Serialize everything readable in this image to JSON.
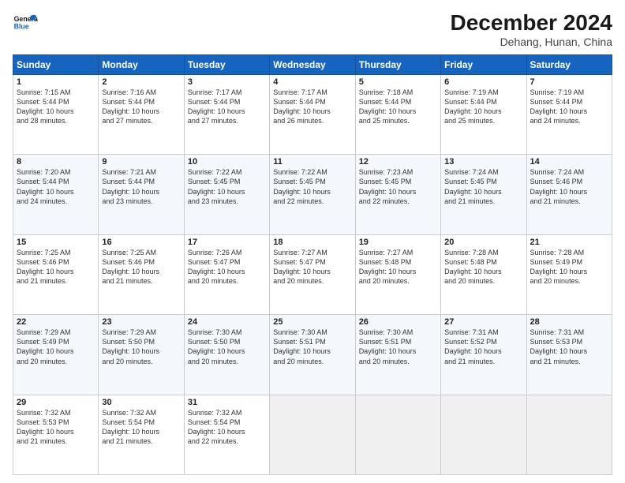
{
  "logo": {
    "line1": "General",
    "line2": "Blue"
  },
  "title": "December 2024",
  "subtitle": "Dehang, Hunan, China",
  "days_of_week": [
    "Sunday",
    "Monday",
    "Tuesday",
    "Wednesday",
    "Thursday",
    "Friday",
    "Saturday"
  ],
  "weeks": [
    [
      {
        "day": 1,
        "info": "Sunrise: 7:15 AM\nSunset: 5:44 PM\nDaylight: 10 hours\nand 28 minutes."
      },
      {
        "day": 2,
        "info": "Sunrise: 7:16 AM\nSunset: 5:44 PM\nDaylight: 10 hours\nand 27 minutes."
      },
      {
        "day": 3,
        "info": "Sunrise: 7:17 AM\nSunset: 5:44 PM\nDaylight: 10 hours\nand 27 minutes."
      },
      {
        "day": 4,
        "info": "Sunrise: 7:17 AM\nSunset: 5:44 PM\nDaylight: 10 hours\nand 26 minutes."
      },
      {
        "day": 5,
        "info": "Sunrise: 7:18 AM\nSunset: 5:44 PM\nDaylight: 10 hours\nand 25 minutes."
      },
      {
        "day": 6,
        "info": "Sunrise: 7:19 AM\nSunset: 5:44 PM\nDaylight: 10 hours\nand 25 minutes."
      },
      {
        "day": 7,
        "info": "Sunrise: 7:19 AM\nSunset: 5:44 PM\nDaylight: 10 hours\nand 24 minutes."
      }
    ],
    [
      {
        "day": 8,
        "info": "Sunrise: 7:20 AM\nSunset: 5:44 PM\nDaylight: 10 hours\nand 24 minutes."
      },
      {
        "day": 9,
        "info": "Sunrise: 7:21 AM\nSunset: 5:44 PM\nDaylight: 10 hours\nand 23 minutes."
      },
      {
        "day": 10,
        "info": "Sunrise: 7:22 AM\nSunset: 5:45 PM\nDaylight: 10 hours\nand 23 minutes."
      },
      {
        "day": 11,
        "info": "Sunrise: 7:22 AM\nSunset: 5:45 PM\nDaylight: 10 hours\nand 22 minutes."
      },
      {
        "day": 12,
        "info": "Sunrise: 7:23 AM\nSunset: 5:45 PM\nDaylight: 10 hours\nand 22 minutes."
      },
      {
        "day": 13,
        "info": "Sunrise: 7:24 AM\nSunset: 5:45 PM\nDaylight: 10 hours\nand 21 minutes."
      },
      {
        "day": 14,
        "info": "Sunrise: 7:24 AM\nSunset: 5:46 PM\nDaylight: 10 hours\nand 21 minutes."
      }
    ],
    [
      {
        "day": 15,
        "info": "Sunrise: 7:25 AM\nSunset: 5:46 PM\nDaylight: 10 hours\nand 21 minutes."
      },
      {
        "day": 16,
        "info": "Sunrise: 7:25 AM\nSunset: 5:46 PM\nDaylight: 10 hours\nand 21 minutes."
      },
      {
        "day": 17,
        "info": "Sunrise: 7:26 AM\nSunset: 5:47 PM\nDaylight: 10 hours\nand 20 minutes."
      },
      {
        "day": 18,
        "info": "Sunrise: 7:27 AM\nSunset: 5:47 PM\nDaylight: 10 hours\nand 20 minutes."
      },
      {
        "day": 19,
        "info": "Sunrise: 7:27 AM\nSunset: 5:48 PM\nDaylight: 10 hours\nand 20 minutes."
      },
      {
        "day": 20,
        "info": "Sunrise: 7:28 AM\nSunset: 5:48 PM\nDaylight: 10 hours\nand 20 minutes."
      },
      {
        "day": 21,
        "info": "Sunrise: 7:28 AM\nSunset: 5:49 PM\nDaylight: 10 hours\nand 20 minutes."
      }
    ],
    [
      {
        "day": 22,
        "info": "Sunrise: 7:29 AM\nSunset: 5:49 PM\nDaylight: 10 hours\nand 20 minutes."
      },
      {
        "day": 23,
        "info": "Sunrise: 7:29 AM\nSunset: 5:50 PM\nDaylight: 10 hours\nand 20 minutes."
      },
      {
        "day": 24,
        "info": "Sunrise: 7:30 AM\nSunset: 5:50 PM\nDaylight: 10 hours\nand 20 minutes."
      },
      {
        "day": 25,
        "info": "Sunrise: 7:30 AM\nSunset: 5:51 PM\nDaylight: 10 hours\nand 20 minutes."
      },
      {
        "day": 26,
        "info": "Sunrise: 7:30 AM\nSunset: 5:51 PM\nDaylight: 10 hours\nand 20 minutes."
      },
      {
        "day": 27,
        "info": "Sunrise: 7:31 AM\nSunset: 5:52 PM\nDaylight: 10 hours\nand 21 minutes."
      },
      {
        "day": 28,
        "info": "Sunrise: 7:31 AM\nSunset: 5:53 PM\nDaylight: 10 hours\nand 21 minutes."
      }
    ],
    [
      {
        "day": 29,
        "info": "Sunrise: 7:32 AM\nSunset: 5:53 PM\nDaylight: 10 hours\nand 21 minutes."
      },
      {
        "day": 30,
        "info": "Sunrise: 7:32 AM\nSunset: 5:54 PM\nDaylight: 10 hours\nand 21 minutes."
      },
      {
        "day": 31,
        "info": "Sunrise: 7:32 AM\nSunset: 5:54 PM\nDaylight: 10 hours\nand 22 minutes."
      },
      null,
      null,
      null,
      null
    ]
  ]
}
